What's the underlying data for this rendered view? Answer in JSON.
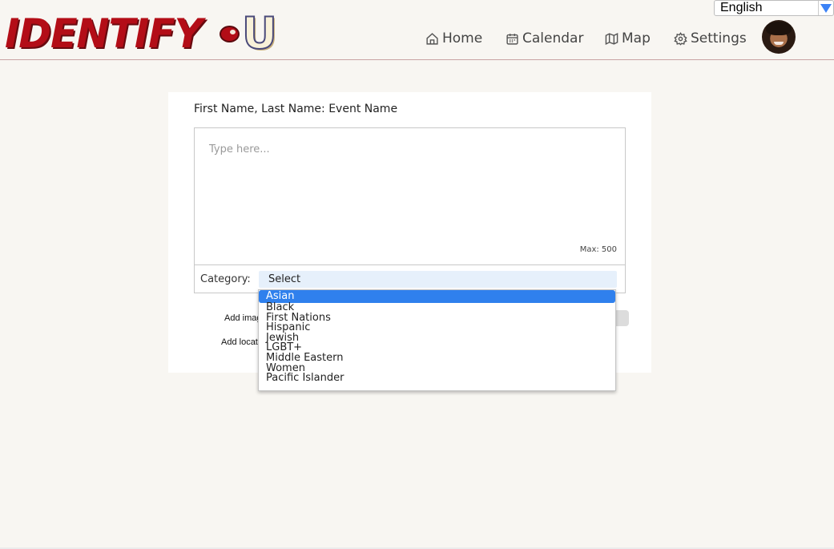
{
  "header": {
    "logo_text": "IDENTIFY",
    "logo_u": "U",
    "nav": [
      {
        "label": "Home",
        "icon": "home-icon"
      },
      {
        "label": "Calendar",
        "icon": "calendar-icon"
      },
      {
        "label": "Map",
        "icon": "map-icon"
      },
      {
        "label": "Settings",
        "icon": "gear-icon"
      }
    ],
    "language": "English"
  },
  "form": {
    "title": "First Name, Last Name: Event Name",
    "description_placeholder": "Type here...",
    "max_label": "Max: 500",
    "category_label": "Category:",
    "category_value": "Select",
    "add_image_label": "Add imag",
    "add_location_label": "Add locat"
  },
  "dropdown": {
    "options": [
      "Asian",
      "Black",
      "First Nations",
      "Hispanic",
      "Jewish",
      "LGBT+",
      "Middle Eastern",
      "Women",
      "Pacific Islander"
    ],
    "highlighted": "Asian"
  },
  "colors": {
    "brand": "#b30d17",
    "highlight": "#2f80ed",
    "background": "#f8f6f2"
  }
}
